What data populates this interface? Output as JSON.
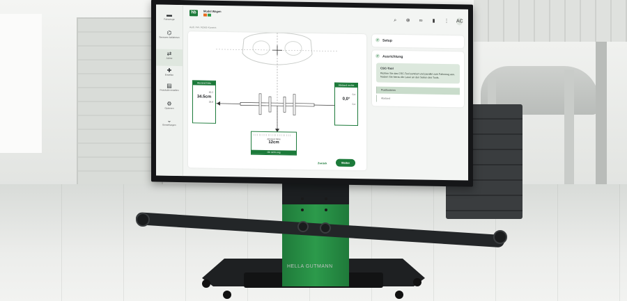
{
  "app": {
    "model_line1": "Model Wagen",
    "model_line2": "",
    "status_orange": "",
    "status_green": ""
  },
  "sidebar": {
    "items": [
      {
        "icon": "folder-icon",
        "label": "Fahrzeuge"
      },
      {
        "icon": "sensor-icon",
        "label": "Sensoren kalibrieren"
      },
      {
        "icon": "align-icon",
        "label": "Achse"
      },
      {
        "icon": "add-icon",
        "label": "Erstellen"
      },
      {
        "icon": "document-icon",
        "label": "Protokolle erstellen"
      },
      {
        "icon": "settings-icon",
        "label": "Optionen"
      },
      {
        "icon": "chevron-down-icon",
        "label": "Einstellungen"
      }
    ]
  },
  "topbar": {
    "icons": [
      "search-icon",
      "link-icon",
      "glasses-icon",
      "battery-icon",
      "menu-icon"
    ],
    "avatar": "AC"
  },
  "breadcrumb": "Audi / A4 / ADAS-Kamera",
  "diagram": {
    "left_gauge": {
      "header": "Abstand links",
      "value": "34.5cm",
      "upper": "40.2",
      "lower": "28.8"
    },
    "right_gauge": {
      "header": "Abstand rechts",
      "value": "0,0°",
      "upper": "0,4",
      "lower": "0,4"
    },
    "bottom_gauge": {
      "header": "Abstand Mitte",
      "value": "12cm",
      "footer": "Ok nicht.eng"
    }
  },
  "panels": {
    "setup": "Setup",
    "alignment": "Ausrichtung",
    "instruction_title": "CSC-Tool",
    "instruction_text": "Richten Sie das CSC-Tool zentriert und parallel zum Fahrzeug aus. Nutzen Sie hierzu die Laser an den Seiten des Tools.",
    "steps": [
      "Positionieren",
      "Abstand"
    ]
  },
  "buttons": {
    "back": "Zurück",
    "next": "Weiter"
  },
  "stand": {
    "brand": "HELLA GUTMANN"
  },
  "colors": {
    "accent": "#1c7a3a",
    "panel_tint": "#dce8dd"
  }
}
